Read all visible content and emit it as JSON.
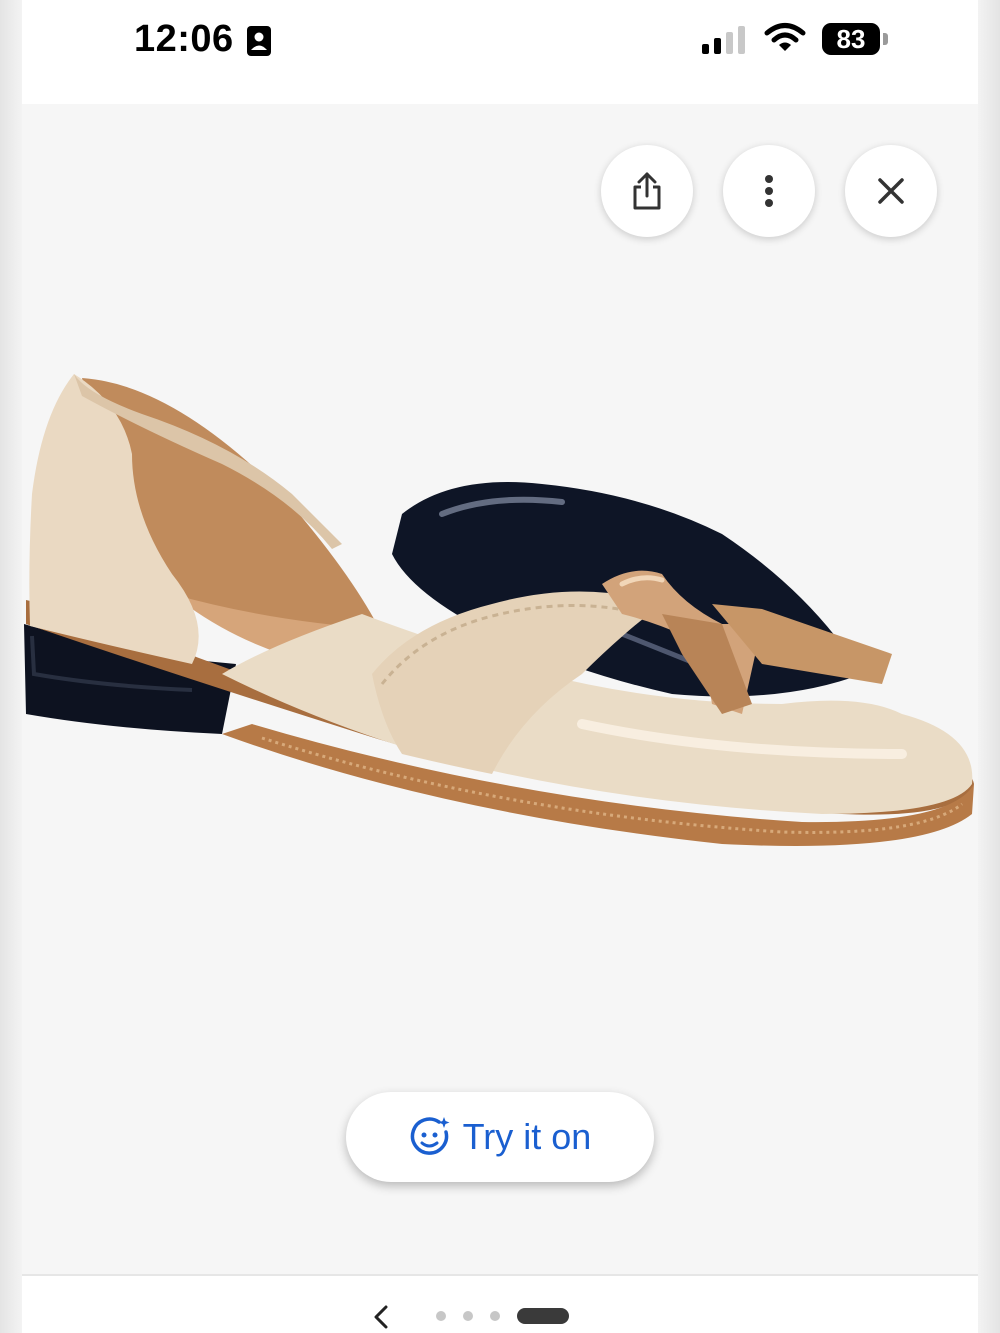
{
  "status_bar": {
    "time": "12:06",
    "battery_level": "83"
  },
  "viewer": {
    "actions": {
      "share_icon": "share-icon",
      "more_icon": "more-vertical-icon",
      "close_icon": "close-icon"
    },
    "try_on": {
      "label": "Try it on",
      "icon": "face-sparkle-icon"
    },
    "accent_color": "#1a5fd0"
  },
  "pager": {
    "back_icon": "chevron-left-icon",
    "page_count": 4,
    "active_index": 3
  }
}
